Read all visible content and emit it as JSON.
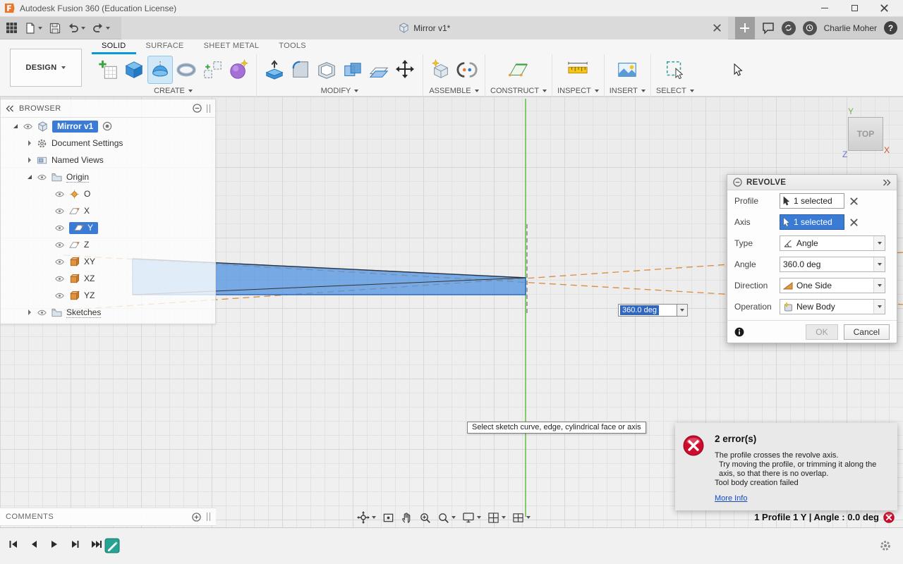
{
  "colors": {
    "accent_blue": "#0a99d6",
    "selection_blue": "#3a7cd5",
    "error_red": "#cf0a2c",
    "shape_blue": "#4a90e2",
    "axis_green": "#6cc04a",
    "dash_orange": "#d98b3a"
  },
  "icons": {
    "help_glyph": "?"
  },
  "titlebar": {
    "title": "Autodesk Fusion 360 (Education License)"
  },
  "tabbar": {
    "doc_tab": "Mirror v1*",
    "user": "Charlie Moher"
  },
  "ribbon": {
    "workspace": "DESIGN",
    "tabs": [
      "SOLID",
      "SURFACE",
      "SHEET METAL",
      "TOOLS"
    ],
    "groups": [
      "CREATE",
      "MODIFY",
      "ASSEMBLE",
      "CONSTRUCT",
      "INSPECT",
      "INSERT",
      "SELECT"
    ]
  },
  "browser": {
    "title": "BROWSER",
    "root": "Mirror v1",
    "items": [
      "Document Settings",
      "Named Views",
      "Origin",
      "O",
      "X",
      "Y",
      "Z",
      "XY",
      "XZ",
      "YZ",
      "Sketches"
    ]
  },
  "viewcube": {
    "face": "TOP",
    "axis_x": "X",
    "axis_y": "Y",
    "axis_z": "Z"
  },
  "dialog": {
    "title": "REVOLVE",
    "rows": {
      "profile": {
        "label": "Profile",
        "value": "1 selected"
      },
      "axis": {
        "label": "Axis",
        "value": "1 selected"
      },
      "type": {
        "label": "Type",
        "value": "Angle"
      },
      "angle": {
        "label": "Angle",
        "value": "360.0 deg"
      },
      "direction": {
        "label": "Direction",
        "value": "One Side"
      },
      "operation": {
        "label": "Operation",
        "value": "New Body"
      }
    },
    "ok": "OK",
    "cancel": "Cancel"
  },
  "canvas": {
    "angle_input": "360.0 deg",
    "tooltip": "Select sketch curve, edge, cylindrical face or axis"
  },
  "errors": {
    "title": "2 error(s)",
    "line1": "The profile crosses the revolve axis.",
    "line2": "Try moving the profile, or trimming it along the axis, so that there is no overlap.",
    "line3": "Tool body creation failed",
    "more": "More Info"
  },
  "statusbar": {
    "comments": "COMMENTS",
    "selection": "1 Profile 1 Y | Angle : 0.0 deg"
  }
}
